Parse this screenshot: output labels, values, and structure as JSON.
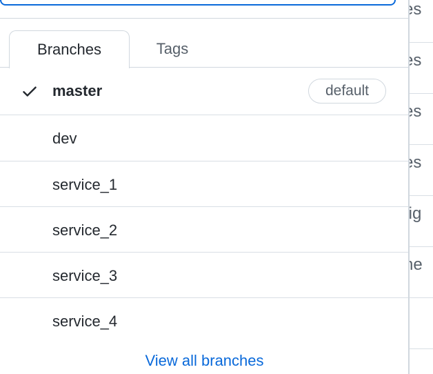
{
  "background": {
    "rows": [
      "es",
      "es",
      "es",
      "es",
      "tig",
      "ne"
    ]
  },
  "filter": {
    "value": "",
    "placeholder": ""
  },
  "tabs": [
    {
      "label": "Branches",
      "active": true
    },
    {
      "label": "Tags",
      "active": false
    }
  ],
  "branches": [
    {
      "name": "master",
      "selected": true,
      "badge": "default"
    },
    {
      "name": "dev",
      "selected": false
    },
    {
      "name": "service_1",
      "selected": false
    },
    {
      "name": "service_2",
      "selected": false
    },
    {
      "name": "service_3",
      "selected": false
    },
    {
      "name": "service_4",
      "selected": false
    }
  ],
  "footer": {
    "view_all_label": "View all branches"
  },
  "colors": {
    "accent": "#0969da",
    "border": "#d0d7de",
    "text": "#24292f",
    "muted": "#57606a"
  },
  "icons": {
    "check": "check-icon"
  }
}
